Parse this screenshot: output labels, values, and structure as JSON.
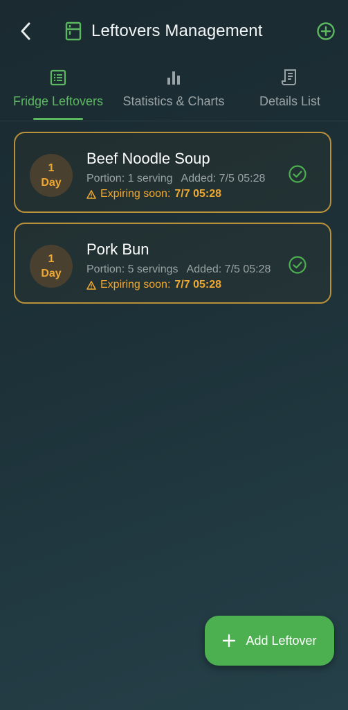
{
  "header": {
    "title": "Leftovers Management",
    "back_icon": "chevron-left-icon",
    "title_icon": "fridge-icon",
    "add_icon": "plus-circle-icon"
  },
  "tabs": [
    {
      "label": "Fridge Leftovers",
      "icon": "list-icon",
      "active": true
    },
    {
      "label": "Statistics & Charts",
      "icon": "bar-chart-icon",
      "active": false
    },
    {
      "label": "Details List",
      "icon": "receipt-icon",
      "active": false
    }
  ],
  "leftovers": [
    {
      "days_num": "1",
      "days_unit": "Day",
      "name": "Beef Noodle Soup",
      "portion": "Portion: 1 serving",
      "added": "Added: 7/5 05:28",
      "expiring_label": "Expiring soon:",
      "expiring_date": "7/7 05:28"
    },
    {
      "days_num": "1",
      "days_unit": "Day",
      "name": "Pork Bun",
      "portion": "Portion: 5 servings",
      "added": "Added: 7/5 05:28",
      "expiring_label": "Expiring soon:",
      "expiring_date": "7/7 05:28"
    }
  ],
  "fab": {
    "label": "Add Leftover",
    "icon": "plus-icon"
  },
  "colors": {
    "accent": "#5cb860",
    "warning": "#f0a830",
    "card_border": "#b8913a",
    "fab": "#4caf50"
  }
}
